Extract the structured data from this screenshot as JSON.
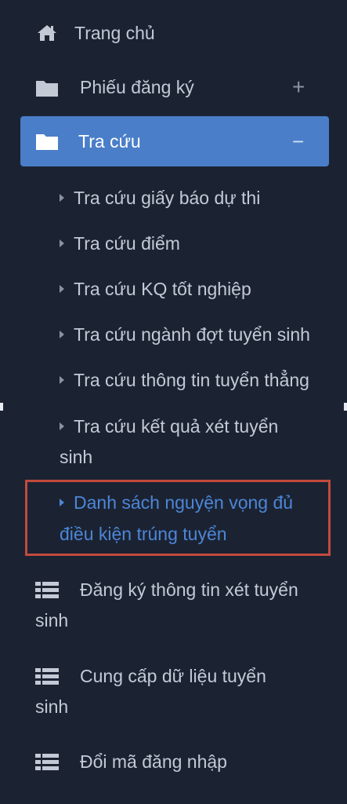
{
  "menu": {
    "home": {
      "label": "Trang chủ",
      "icon": "home-icon"
    },
    "registration": {
      "label": "Phiếu đăng ký",
      "icon": "folder-icon",
      "toggle": "+"
    },
    "lookup": {
      "label": "Tra cứu",
      "icon": "folder-open-icon",
      "toggle": "−",
      "items": [
        "Tra cứu giấy báo dự thi",
        "Tra cứu điểm",
        "Tra cứu KQ tốt nghiệp",
        "Tra cứu ngành đợt tuyển sinh",
        "Tra cứu thông tin tuyển thẳng",
        "Tra cứu kết quả xét tuyển",
        "sinh",
        "Danh sách nguyện vọng đủ",
        "điều kiện trúng tuyển"
      ]
    },
    "register_info": {
      "line1": "Đăng ký thông tin xét tuyển",
      "line2": "sinh",
      "icon": "list-icon"
    },
    "provide_data": {
      "line1": "Cung cấp dữ liệu tuyển",
      "line2": "sinh",
      "icon": "list-icon"
    },
    "change_password": {
      "label": "Đổi mã đăng nhập",
      "icon": "list-icon"
    }
  },
  "colors": {
    "background": "#1b2333",
    "active": "#4a7ec8",
    "highlight_border": "#c24a3d",
    "highlight_text": "#4d86d6"
  }
}
